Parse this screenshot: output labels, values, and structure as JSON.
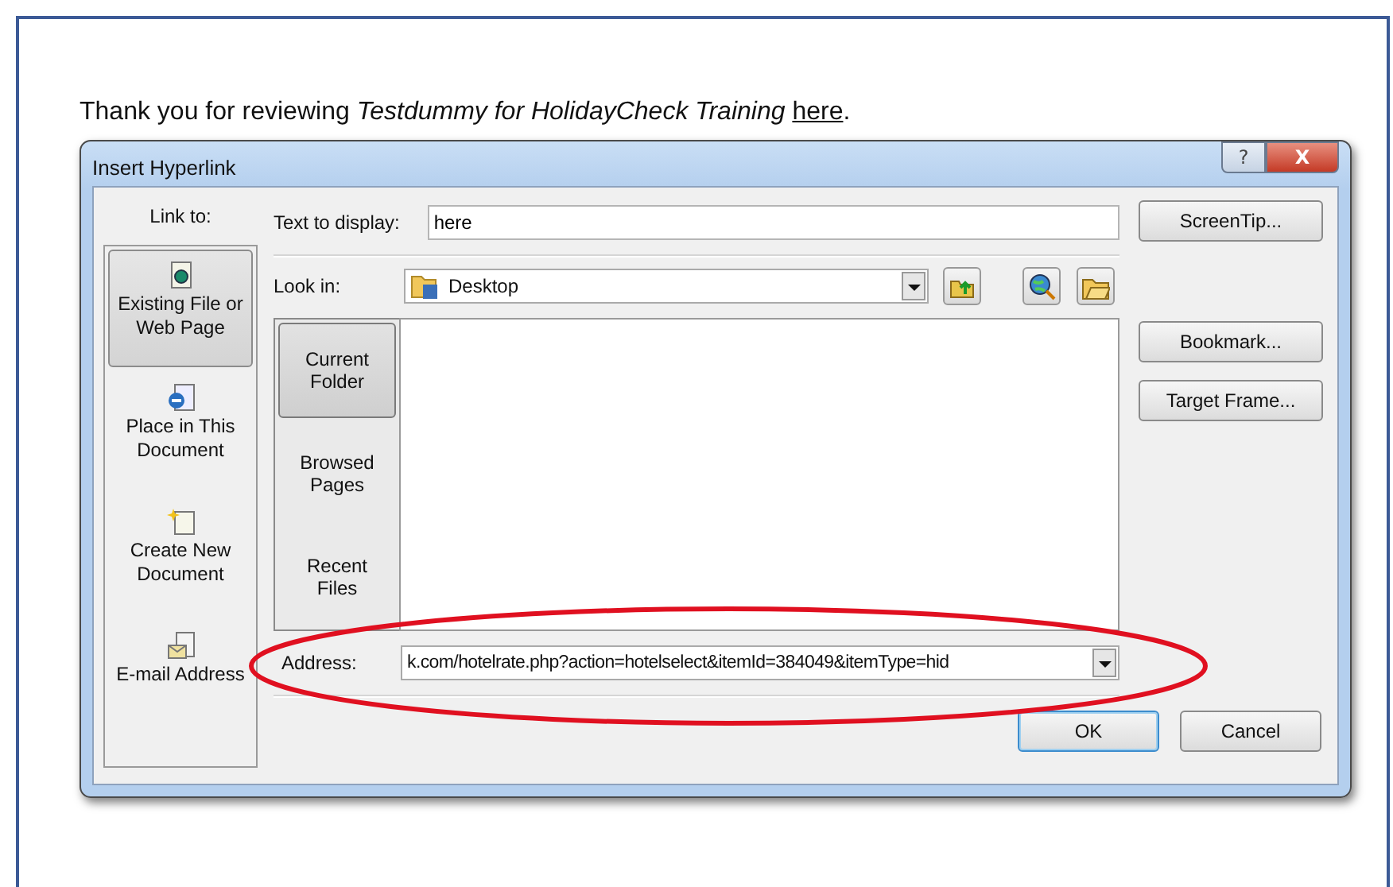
{
  "intro": {
    "before": "Thank you for reviewing *Testdummy for HolidayCheck Training* ",
    "link": "here",
    "after": "."
  },
  "dialog": {
    "title": "Insert Hyperlink",
    "title_buttons": [
      {
        "kind": "help",
        "label": "?"
      },
      {
        "kind": "close",
        "label": "X"
      }
    ],
    "link_to": {
      "label": "Link to:",
      "items": [
        {
          "kind": "file",
          "label": "Existing File or Web Page",
          "selected": true
        },
        {
          "kind": "place",
          "label": "Place in This Document",
          "selected": false
        },
        {
          "kind": "new",
          "label": "Create New Document",
          "selected": false
        },
        {
          "kind": "email",
          "label": "E-mail Address",
          "selected": false
        }
      ]
    },
    "text_to_display": {
      "label": "Text to display:",
      "value": "here"
    },
    "look_in": {
      "label": "Look in:",
      "value": "Desktop"
    },
    "tools": [
      {
        "kind": "up"
      },
      {
        "kind": "web"
      },
      {
        "kind": "folder"
      }
    ],
    "views": [
      {
        "label": "Current Folder",
        "selected": true
      },
      {
        "label": "Browsed Pages",
        "selected": false
      },
      {
        "label": "Recent Files",
        "selected": false
      }
    ],
    "side_buttons": [
      "ScreenTip...",
      "Bookmark...",
      "Target Frame..."
    ],
    "address": {
      "label": "Address:",
      "value": "k.com/hotelrate.php?action=hotelselect&itemId=384049&itemType=hid"
    },
    "buttons": [
      {
        "label": "OK",
        "default": true
      },
      {
        "label": "Cancel",
        "default": false
      }
    ]
  },
  "annotation": {
    "kind": "ellipse"
  }
}
